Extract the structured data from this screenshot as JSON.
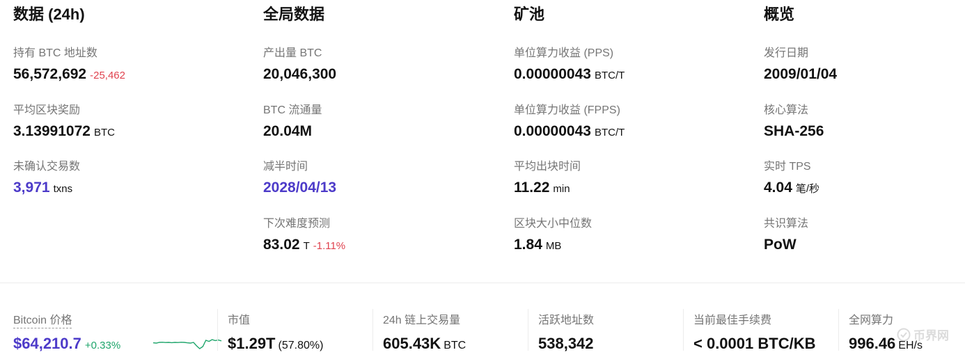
{
  "columns": [
    {
      "title": "数据 (24h)",
      "items": [
        {
          "label": "持有 BTC 地址数",
          "value": "56,572,692",
          "unit": "",
          "change": "-25,462",
          "change_dir": "neg"
        },
        {
          "label": "平均区块奖励",
          "value": "3.13991072",
          "unit": "BTC",
          "change": ""
        },
        {
          "label": "未确认交易数",
          "value": "3,971",
          "unit": "txns",
          "change": "",
          "accent": true
        }
      ]
    },
    {
      "title": "全局数据",
      "items": [
        {
          "label": "产出量 BTC",
          "value": "20,046,300",
          "unit": "",
          "change": ""
        },
        {
          "label": "BTC 流通量",
          "value": "20.04M",
          "unit": "",
          "change": ""
        },
        {
          "label": "减半时间",
          "value": "2028/04/13",
          "unit": "",
          "change": "",
          "accent": true
        },
        {
          "label": "下次难度预测",
          "value": "83.02",
          "unit": "T",
          "change": "-1.11%",
          "change_dir": "neg"
        }
      ]
    },
    {
      "title": "矿池",
      "items": [
        {
          "label": "单位算力收益 (PPS)",
          "value": "0.00000043",
          "unit": "BTC/T",
          "change": ""
        },
        {
          "label": "单位算力收益 (FPPS)",
          "value": "0.00000043",
          "unit": "BTC/T",
          "change": ""
        },
        {
          "label": "平均出块时间",
          "value": "11.22",
          "unit": "min",
          "change": ""
        },
        {
          "label": "区块大小中位数",
          "value": "1.84",
          "unit": "MB",
          "change": ""
        }
      ]
    },
    {
      "title": "概览",
      "items": [
        {
          "label": "发行日期",
          "value": "2009/01/04",
          "unit": "",
          "change": ""
        },
        {
          "label": "核心算法",
          "value": "SHA-256",
          "unit": "",
          "change": ""
        },
        {
          "label": "实时 TPS",
          "value": "4.04",
          "unit": "笔/秒",
          "change": ""
        },
        {
          "label": "共识算法",
          "value": "PoW",
          "unit": "",
          "change": ""
        }
      ]
    }
  ],
  "metrics": [
    {
      "label": "Bitcoin 价格",
      "value": "$64,210.7",
      "unit": "",
      "change": "+0.33%",
      "change_dir": "pos",
      "accent": true,
      "underline": true,
      "has_sparkline": true
    },
    {
      "label": "市值",
      "value": "$1.29T",
      "unit": "(57.80%)",
      "change": ""
    },
    {
      "label": "24h 链上交易量",
      "value": "605.43K",
      "unit": "BTC",
      "change": ""
    },
    {
      "label": "活跃地址数",
      "value": "538,342",
      "unit": "",
      "change": ""
    },
    {
      "label": "当前最佳手续费",
      "value": "< 0.0001 BTC/KB",
      "unit": "",
      "change": ""
    },
    {
      "label": "全网算力",
      "value": "996.46",
      "unit": "EH/s",
      "change": ""
    }
  ],
  "sparkline": {
    "color": "#1ea56b",
    "values": [
      0.52,
      0.5,
      0.55,
      0.56,
      0.54,
      0.55,
      0.53,
      0.55,
      0.54,
      0.56,
      0.55,
      0.52,
      0.5,
      0.55,
      0.3,
      0.1,
      0.25,
      0.7,
      0.62,
      0.75,
      0.68,
      0.72,
      0.66
    ]
  },
  "watermark": {
    "text": "币界网",
    "icon": "coin-logo-icon"
  },
  "colors": {
    "accent": "#4d3bc9",
    "negative": "#e0434f",
    "positive": "#1ea56b",
    "label": "#757575"
  }
}
